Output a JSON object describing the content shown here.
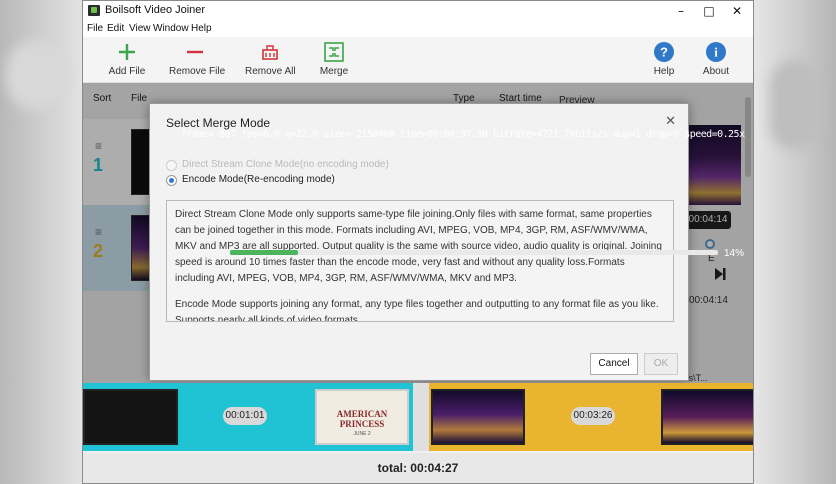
{
  "window": {
    "title": "Boilsoft Video Joiner"
  },
  "menu": [
    "File",
    "Edit",
    "View",
    "Window",
    "Help"
  ],
  "toolbar": {
    "add": "Add File",
    "remove": "Remove File",
    "remove_all": "Remove All",
    "merge": "Merge",
    "help": "Help",
    "about": "About"
  },
  "list": {
    "headers": {
      "sort": "Sort",
      "file": "File",
      "type": "Type",
      "start": "Start time",
      "preview": "Preview"
    },
    "rows": [
      {
        "num": "1"
      },
      {
        "num": "2"
      }
    ]
  },
  "preview": {
    "time": "00:04:14",
    "label_e": "E",
    "duration": "00:04:14",
    "path": "...Tunes\\T..."
  },
  "dialog": {
    "title": "Select Merge Mode",
    "option1": "Direct Stream Clone Mode(no encoding mode)",
    "option2": "Encode Mode(Re-encoding mode)",
    "desc1": "Direct Stream Clone Mode only supports same-type file joining.Only files with same format, same properties can be joined together in this mode. Formats including AVI, MPEG, VOB, MP4, 3GP, RM, ASF/WMV/WMA, MKV and MP3 are all supported. Output quality is the same with source video, audio quality is original. Joining speed is around 10 times faster than the encode mode, very fast and without any quality loss.Formats including AVI, MPEG, VOB, MP4, 3GP, RM, ASF/WMV/WMA, MKV and MP3.",
    "desc2": "Encode Mode supports joining any format, any type files together and outputting to any format file as you like. Supports nearly all kinds of video formats.",
    "cancel": "Cancel",
    "ok": "OK"
  },
  "progress": {
    "ffmpeg": "frame= 897 fps=6.0 q=22.0 size= 21504kB time=00:00:37.30 bitrate=4721.7kbits/s dup=1 drop=0 speed=0.25x",
    "percent_label": "14%",
    "value": 0.14
  },
  "timeline": {
    "t1": "00:01:01",
    "t2": "00:03:26",
    "poster_title": "AMERICAN PRINCESS",
    "poster_date": "JUNE 2",
    "total": "total: 00:04:27"
  },
  "colors": {
    "cyan": "#20c3d3",
    "gold": "#e9b52e",
    "accent": "#2a7ad2"
  }
}
